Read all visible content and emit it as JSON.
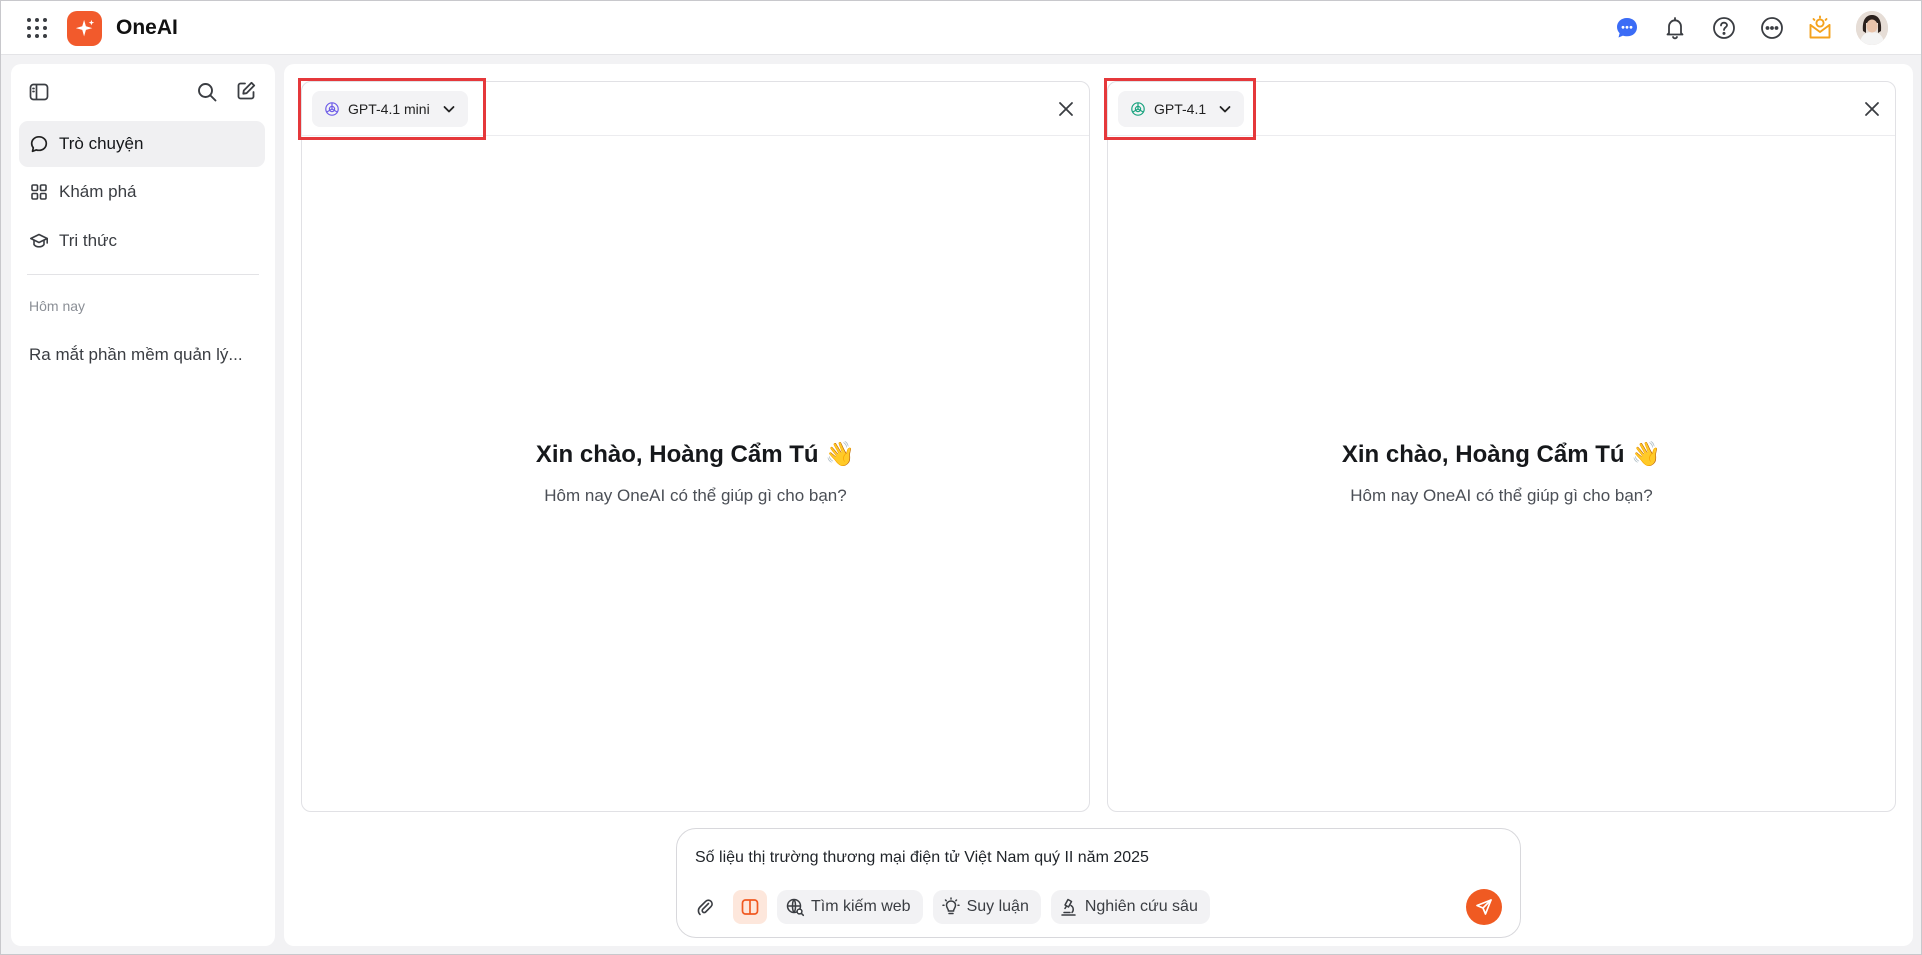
{
  "app": {
    "name": "OneAI"
  },
  "sidebar": {
    "items": [
      {
        "label": "Trò chuyện",
        "icon": "chat-bubble-icon",
        "active": true
      },
      {
        "label": "Khám phá",
        "icon": "grid-icon",
        "active": false
      },
      {
        "label": "Tri thức",
        "icon": "graduation-cap-icon",
        "active": false
      }
    ],
    "section_label": "Hôm nay",
    "history": [
      "Ra mắt phần mềm quản lý..."
    ]
  },
  "panels": [
    {
      "model": "GPT-4.1 mini",
      "model_icon_color": "#6d5ce8",
      "greeting": "Xin chào, Hoàng Cẩm Tú 👋",
      "subtitle": "Hôm nay OneAI có thể giúp gì cho bạn?"
    },
    {
      "model": "GPT-4.1",
      "model_icon_color": "#19a37f",
      "greeting": "Xin chào, Hoàng Cẩm Tú 👋",
      "subtitle": "Hôm nay OneAI có thể giúp gì cho bạn?"
    }
  ],
  "composer": {
    "value": "Số liệu thị trường thương mại điện tử Việt Nam quý II năm 2025",
    "tools": [
      "Tìm kiếm web",
      "Suy luận",
      "Nghiên cứu sâu"
    ]
  },
  "colors": {
    "accent": "#f05a22",
    "highlight": "#e5383b",
    "chat_icon": "#3b6cf6",
    "gift_icon": "#f4a21c"
  }
}
